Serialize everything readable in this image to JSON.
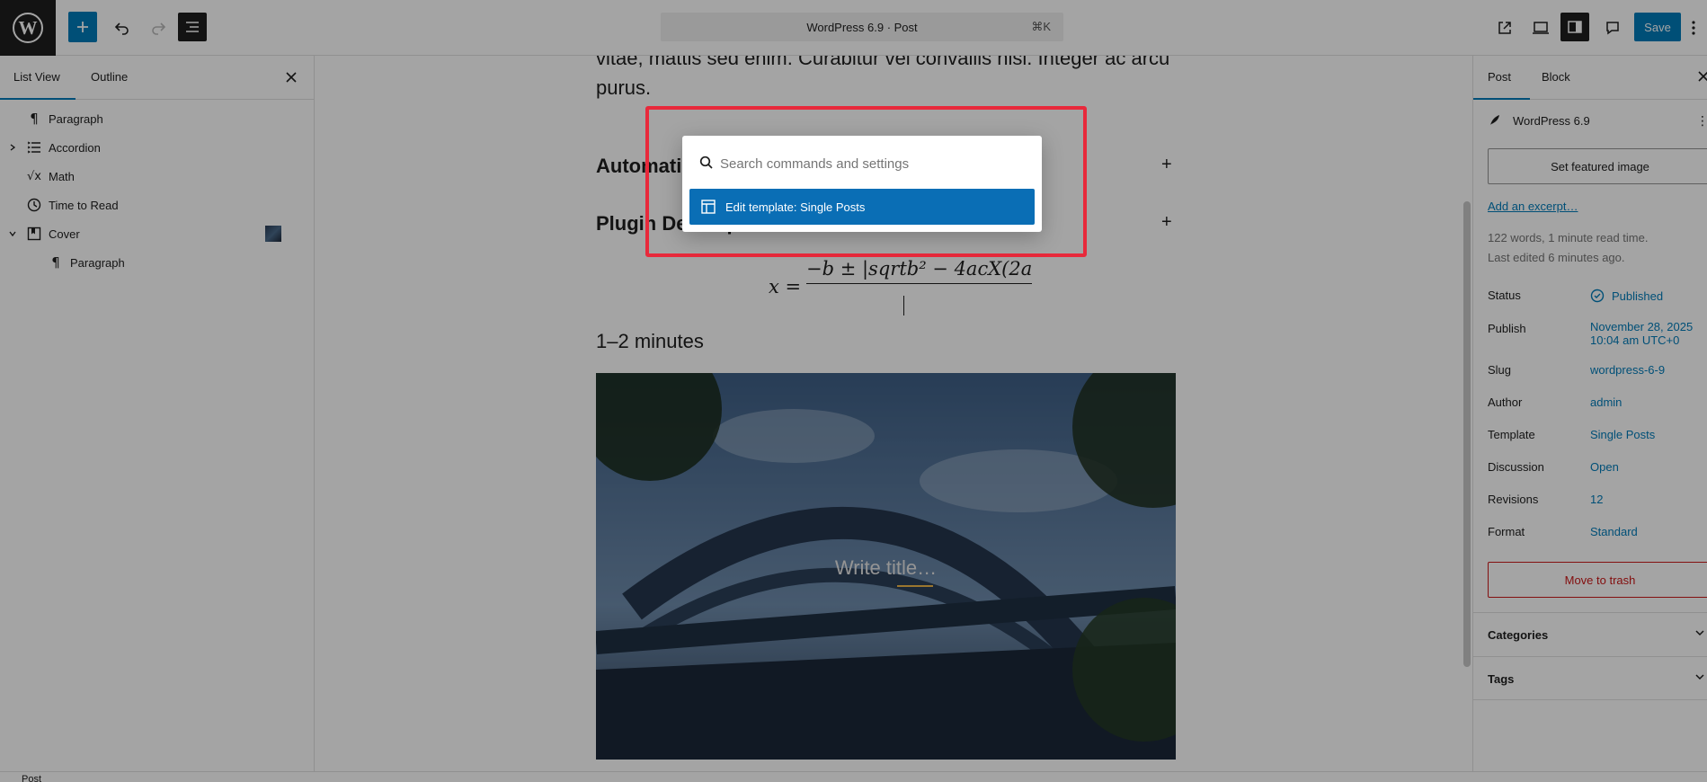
{
  "topbar": {
    "command_center": "WordPress 6.9 · Post",
    "shortcut": "⌘K",
    "save_label": "Save"
  },
  "left_panel": {
    "tabs": [
      "List View",
      "Outline"
    ],
    "tree": [
      {
        "label": "Paragraph",
        "icon": "paragraph-icon",
        "depth": 0,
        "expandable": false
      },
      {
        "label": "Accordion",
        "icon": "accordion-icon",
        "depth": 0,
        "expandable": true,
        "expanded": false
      },
      {
        "label": "Math",
        "icon": "math-icon",
        "depth": 0,
        "expandable": false
      },
      {
        "label": "Time to Read",
        "icon": "clock-icon",
        "depth": 0,
        "expandable": false
      },
      {
        "label": "Cover",
        "icon": "cover-icon",
        "depth": 0,
        "expandable": true,
        "expanded": true
      },
      {
        "label": "Paragraph",
        "icon": "paragraph-icon",
        "depth": 1,
        "expandable": false
      }
    ]
  },
  "editor": {
    "paragraph_text": "vitae, mattis sed enim. Curabitur vel convallis nisl. Integer ac arcu purus.",
    "accordion_items": [
      "Automatic Updates",
      "Plugin Development"
    ],
    "math_lhs": "x =",
    "math_numerator": "−b ± |sqrtb² − 4acX(2a",
    "time_to_read": "1–2 minutes",
    "cover_placeholder": "Write title…"
  },
  "right_panel": {
    "tabs": [
      "Post",
      "Block"
    ],
    "doc_title": "WordPress 6.9",
    "featured_image_label": "Set featured image",
    "excerpt_link": "Add an excerpt…",
    "meta_words": "122 words, 1 minute read time.",
    "meta_edited": "Last edited 6 minutes ago.",
    "rows": [
      {
        "key": "Status",
        "value": "Published"
      },
      {
        "key": "Publish",
        "value": "November 28, 2025",
        "value2": "10:04 am UTC+0"
      },
      {
        "key": "Slug",
        "value": "wordpress-6-9"
      },
      {
        "key": "Author",
        "value": "admin"
      },
      {
        "key": "Template",
        "value": "Single Posts"
      },
      {
        "key": "Discussion",
        "value": "Open"
      },
      {
        "key": "Revisions",
        "value": "12"
      },
      {
        "key": "Format",
        "value": "Standard"
      }
    ],
    "trash_label": "Move to trash",
    "sections": [
      "Categories",
      "Tags"
    ]
  },
  "footer": {
    "breadcrumb": "Post"
  },
  "command_palette": {
    "placeholder": "Search commands and settings",
    "items": [
      {
        "label": "Edit template: Single Posts",
        "icon": "layout-icon",
        "selected": true
      }
    ]
  },
  "colors": {
    "accent": "#007cba",
    "highlight_border": "#e8293b",
    "danger": "#cc1818"
  }
}
